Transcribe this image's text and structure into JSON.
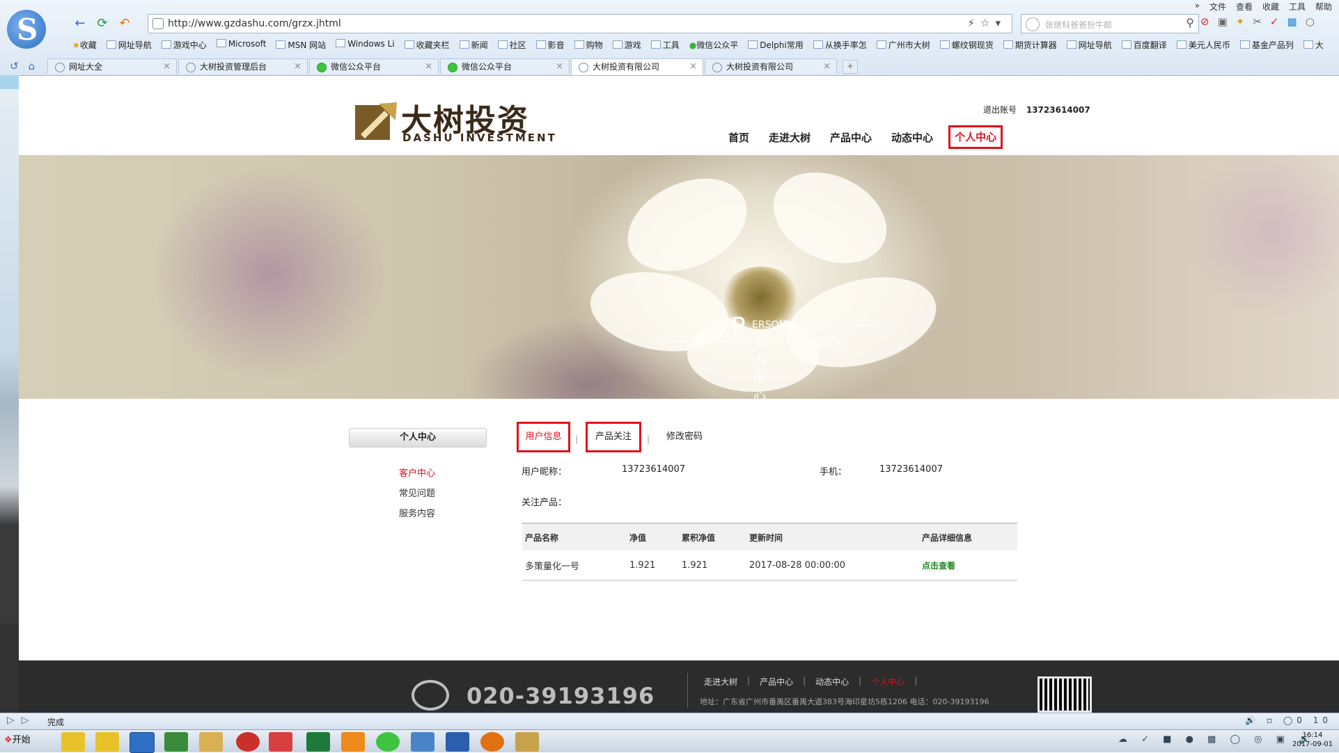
{
  "browser": {
    "menu": [
      "»",
      "文件",
      "查看",
      "收藏",
      "工具",
      "帮助"
    ],
    "url": "http://www.gzdashu.com/grzx.jhtml",
    "search_placeholder": "张继科爸爸扮牛郎",
    "bookmarks": [
      "收藏",
      "网址导航",
      "游戏中心",
      "Microsoft",
      "MSN 网站",
      "Windows Li",
      "收藏夹栏",
      "新闻",
      "社区",
      "影音",
      "购物",
      "游戏",
      "工具",
      "微信公众平",
      "Delphi常用",
      "从换手率怎",
      "广州市大树",
      "螺纹钢现货",
      "期货计算器",
      "网址导航",
      "百度翻译",
      "美元人民币",
      "基金产品列",
      "大"
    ],
    "tabs": [
      {
        "label": "网址大全",
        "icon": "globe"
      },
      {
        "label": "大树投资管理后台",
        "icon": "page"
      },
      {
        "label": "微信公众平台",
        "icon": "wechat"
      },
      {
        "label": "微信公众平台",
        "icon": "wechat"
      },
      {
        "label": "大树投资有限公司",
        "icon": "page",
        "active": true
      },
      {
        "label": "大树投资有限公司",
        "icon": "page"
      }
    ],
    "new_tab": "+",
    "status": "完成",
    "status_right": "0   10"
  },
  "site": {
    "brand_cn": "大树投资",
    "brand_en": "DASHU INVESTMENT",
    "logout": "退出账号",
    "account": "13723614007",
    "nav": [
      "首页",
      "走进大树",
      "产品中心",
      "动态中心",
      "个人中心"
    ],
    "banner": {
      "big": "P",
      "en1": "ERSONAL",
      "cn": "个人中心",
      "en2": "USER"
    },
    "sidebar": {
      "title": "个人中心",
      "items": [
        "客户中心",
        "常见问题",
        "服务内容"
      ]
    },
    "subtabs": [
      "用户信息",
      "产品关注",
      "修改密码"
    ],
    "sep": "|",
    "profile": {
      "nickname_label": "用户昵称：",
      "nickname": "13723614007",
      "phone_label": "手机：",
      "phone": "13723614007",
      "followed_label": "关注产品："
    },
    "table": {
      "headers": [
        "产品名称",
        "净值",
        "累积净值",
        "更新时间",
        "产品详细信息"
      ],
      "rows": [
        {
          "name": "多策量化一号",
          "nav": "1.921",
          "acc_nav": "1.921",
          "updated": "2017-08-28 00:00:00",
          "detail": "点击查看"
        }
      ]
    },
    "footer": {
      "phone": "020-39193196",
      "nav": [
        "走进大树",
        "产品中心",
        "动态中心",
        "个人中心"
      ],
      "address": "地址：广东省广州市番禺区番禺大道383号海印星坊5栋1206 电话：020-39193196"
    }
  },
  "taskbar": {
    "start": "开始",
    "clock_time": "16:14",
    "clock_date": "2017-09-01"
  },
  "colors": {
    "accent_red": "#e0121b",
    "link_green": "#1e8a1e",
    "footer_bg": "#2c2c2c"
  }
}
